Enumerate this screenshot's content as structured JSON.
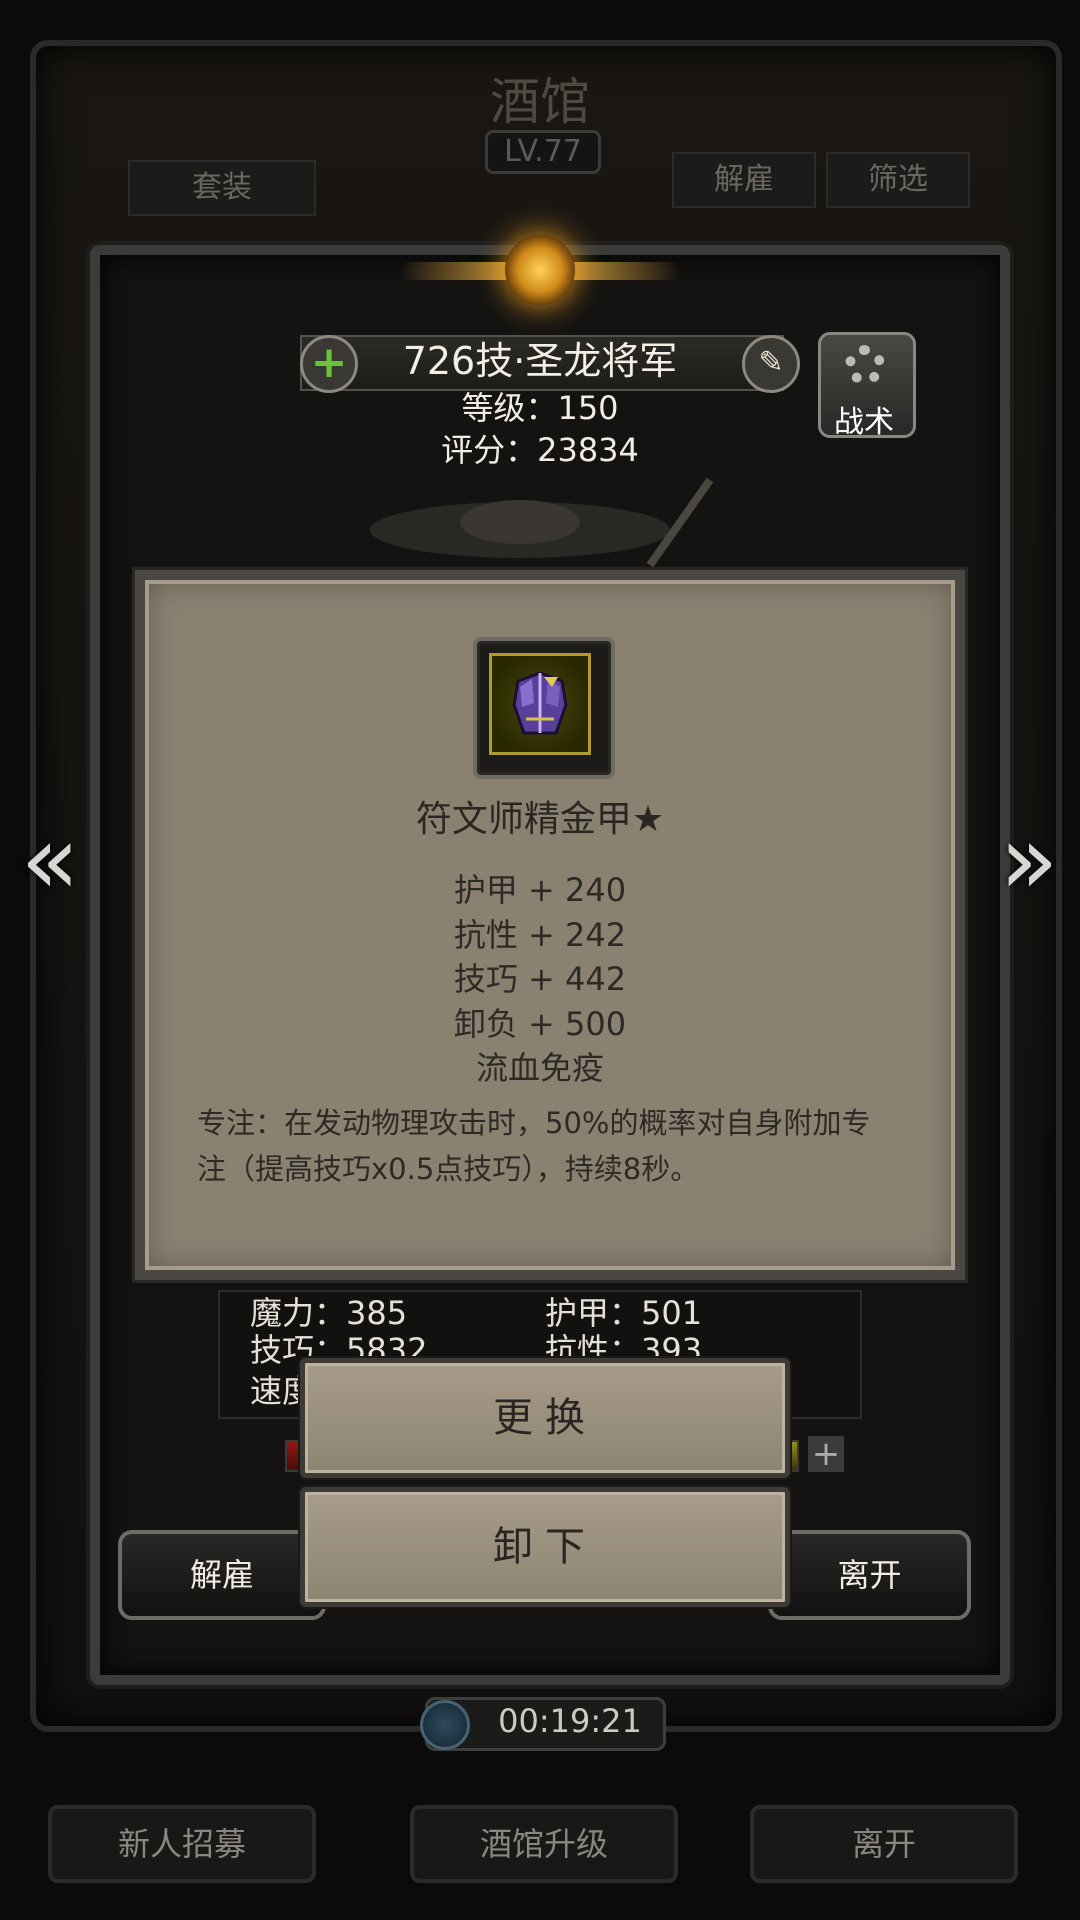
{
  "tavern": {
    "title": "酒馆",
    "level": "LV.77",
    "set_label": "套装",
    "dismiss_label": "解雇",
    "filter_label": "筛选",
    "timer": "00:19:21",
    "recruit_label": "新人招募",
    "upgrade_label": "酒馆升级",
    "leave_label": "离开"
  },
  "hero": {
    "name": "726技·圣龙将军",
    "level_line": "等级：150",
    "score_line": "评分：23834",
    "tactics_label": "战术",
    "stats": {
      "magic": "魔力：385",
      "armor": "护甲：501",
      "skill": "技巧：5832",
      "resist": "抗性：393",
      "speed": "速度"
    },
    "dismiss_label": "解雇",
    "leave_label": "离开"
  },
  "item": {
    "name": "符文师精金甲★",
    "attributes": [
      "护甲 + 240",
      "抗性 + 242",
      "技巧 + 442",
      "卸负 + 500",
      "流血免疫"
    ],
    "description": "专注：在发动物理攻击时，50%的概率对自身附加专注（提高技巧x0.5点技巧），持续8秒。",
    "icon": "armor-icon"
  },
  "actions": {
    "replace_label": "更换",
    "unequip_label": "卸下"
  },
  "colors": {
    "popup_bg": "#8b8171",
    "hp_bar": "#8d1a12",
    "exp_bar": "#9a8a24",
    "plus_green": "#6ac23b"
  }
}
